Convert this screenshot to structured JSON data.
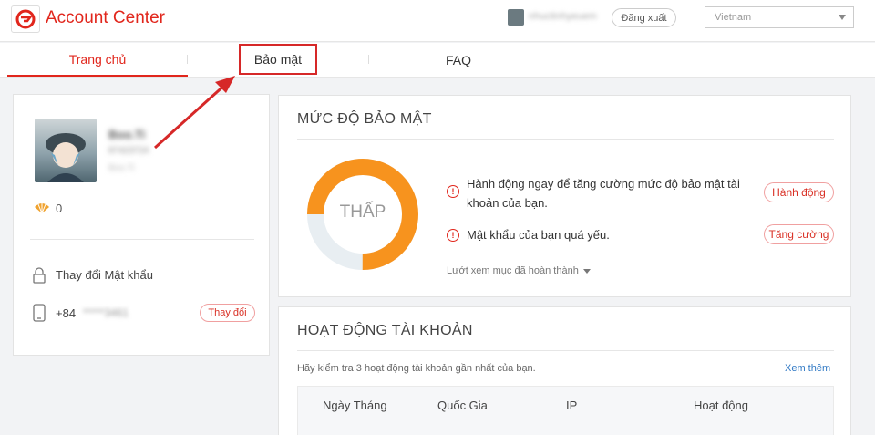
{
  "header": {
    "app_title": "Account Center",
    "logo_icon": "garena-logo-icon",
    "user_name": "nhuctinhyeuem",
    "logout_label": "Đăng xuất",
    "country": "Vietnam"
  },
  "tabs": [
    {
      "label": "Trang chủ",
      "active": true
    },
    {
      "label": "Bảo mật",
      "highlighted": true
    },
    {
      "label": "FAQ"
    }
  ],
  "profile": {
    "name": "Boo.Ti",
    "id": "87423724",
    "sub": "Boo.Ti",
    "shells": "0",
    "change_password": "Thay đổi Mật khẩu",
    "phone_prefix": "+84",
    "phone_mask": "*****3461",
    "change_phone": "Thay đổi"
  },
  "security": {
    "title": "MỨC ĐỘ BẢO MẬT",
    "level": "THẤP",
    "level_fraction": 0.75,
    "alert1": "Hành động ngay để tăng cường mức độ bảo mật tài khoản của bạn.",
    "alert1_button": "Hành động",
    "alert2": "Mật khẩu của bạn quá yếu.",
    "alert2_button": "Tăng cường",
    "view_done": "Lướt xem mục đã hoàn thành"
  },
  "activity": {
    "title": "HOẠT ĐỘNG TÀI KHOẢN",
    "desc": "Hãy kiểm tra 3 hoạt động tài khoản gần nhất của bạn.",
    "see_more": "Xem thêm",
    "columns": [
      "Ngày Tháng",
      "Quốc Gia",
      "IP",
      "Hoạt động"
    ]
  },
  "colors": {
    "brand": "#e1261c",
    "donut_fill": "#f7931e",
    "donut_track": "#e8eef2"
  }
}
